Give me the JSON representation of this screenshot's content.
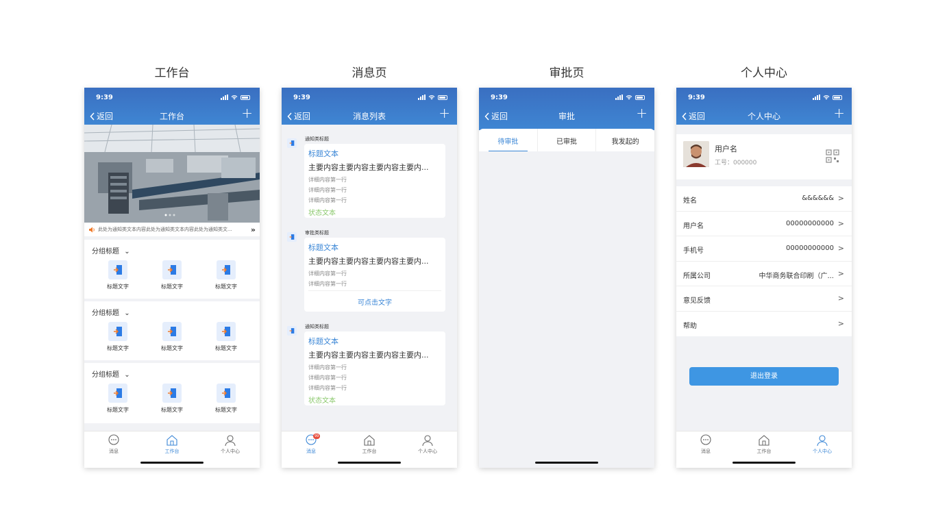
{
  "screens": {
    "workbench": "工作台",
    "messages": "消息页",
    "approval": "审批页",
    "profile": "个人中心"
  },
  "status": {
    "time": "9:39"
  },
  "nav": {
    "back": "返回",
    "plus": "+"
  },
  "tabbar": {
    "messages": "消息",
    "workbench": "工作台",
    "profile": "个人中心"
  },
  "workbench": {
    "title": "工作台",
    "notice": "此处为通知类文本内容此处为通知类文本内容此处为通知类文...",
    "groups": [
      {
        "title": "分组标题",
        "items": [
          "标题文字",
          "标题文字",
          "标题文字"
        ]
      },
      {
        "title": "分组标题",
        "items": [
          "标题文字",
          "标题文字",
          "标题文字"
        ]
      },
      {
        "title": "分组标题",
        "items": [
          "标题文字",
          "标题文字",
          "标题文字"
        ]
      }
    ]
  },
  "messages": {
    "title": "消息列表",
    "badge": "99",
    "blocks": [
      {
        "label": "通知类标题",
        "title": "标题文本",
        "main": "主要内容主要内容主要内容主要内...",
        "lines": [
          "详细内容第一行",
          "详细内容第一行",
          "详细内容第一行"
        ],
        "status": "状态文本"
      },
      {
        "label": "审批类标题",
        "title": "标题文本",
        "main": "主要内容主要内容主要内容主要内...",
        "lines": [
          "详细内容第一行",
          "详细内容第一行"
        ],
        "link": "可点击文字"
      },
      {
        "label": "通知类标题",
        "title": "标题文本",
        "main": "主要内容主要内容主要内容主要内...",
        "lines": [
          "详细内容第一行",
          "详细内容第一行",
          "详细内容第一行"
        ],
        "status": "状态文本"
      }
    ]
  },
  "approval": {
    "title": "审批",
    "tabs": [
      "待审批",
      "已审批",
      "我发起的"
    ]
  },
  "profile": {
    "title": "个人中心",
    "username": "用户名",
    "employee_id": "工号：000000",
    "rows": [
      {
        "label": "姓名",
        "value": "&&&&&&"
      },
      {
        "label": "用户名",
        "value": "00000000000"
      },
      {
        "label": "手机号",
        "value": "00000000000"
      },
      {
        "label": "所属公司",
        "value": "中华商务联合印刷（广..."
      },
      {
        "label": "意见反馈",
        "value": ""
      },
      {
        "label": "帮助",
        "value": ""
      }
    ],
    "logout": "退出登录"
  },
  "colors": {
    "primary": "#3a86d6",
    "header_gradient_top": "#3a6fc1",
    "status_green": "#8cc96e",
    "logout_button": "#3e96e3"
  },
  "icons": {
    "back": "chevron-left-icon",
    "add": "plus-icon",
    "notice": "speaker-icon",
    "more": "double-chevron-right-icon",
    "expand": "chevron-down-icon",
    "app": "app-entry-icon",
    "qr": "qr-code-icon",
    "chat": "chat-bubble-icon",
    "home": "home-icon",
    "person": "person-icon"
  }
}
